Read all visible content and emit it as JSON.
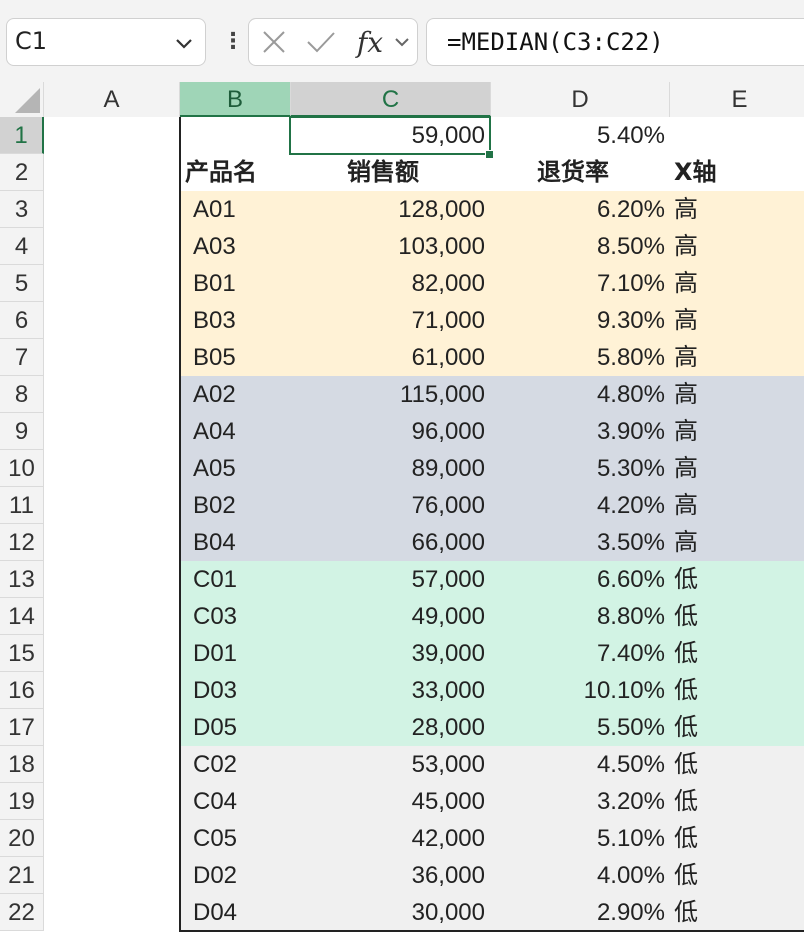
{
  "name_box": {
    "value": "C1"
  },
  "formula_bar": {
    "formula": "=MEDIAN(C3:C22)"
  },
  "columns": [
    "A",
    "B",
    "C",
    "D",
    "E"
  ],
  "header_row": {
    "product": "产品名",
    "sales": "销售额",
    "return_rate": "退货率",
    "x_axis": "X轴"
  },
  "row1": {
    "C": "59,000",
    "D": "5.40%"
  },
  "rows": [
    {
      "num": "3",
      "product": "A01",
      "sales": "128,000",
      "rate": "6.20%",
      "x": "高"
    },
    {
      "num": "4",
      "product": "A03",
      "sales": "103,000",
      "rate": "8.50%",
      "x": "高"
    },
    {
      "num": "5",
      "product": "B01",
      "sales": "82,000",
      "rate": "7.10%",
      "x": "高"
    },
    {
      "num": "6",
      "product": "B03",
      "sales": "71,000",
      "rate": "9.30%",
      "x": "高"
    },
    {
      "num": "7",
      "product": "B05",
      "sales": "61,000",
      "rate": "5.80%",
      "x": "高"
    },
    {
      "num": "8",
      "product": "A02",
      "sales": "115,000",
      "rate": "4.80%",
      "x": "高"
    },
    {
      "num": "9",
      "product": "A04",
      "sales": "96,000",
      "rate": "3.90%",
      "x": "高"
    },
    {
      "num": "10",
      "product": "A05",
      "sales": "89,000",
      "rate": "5.30%",
      "x": "高"
    },
    {
      "num": "11",
      "product": "B02",
      "sales": "76,000",
      "rate": "4.20%",
      "x": "高"
    },
    {
      "num": "12",
      "product": "B04",
      "sales": "66,000",
      "rate": "3.50%",
      "x": "高"
    },
    {
      "num": "13",
      "product": "C01",
      "sales": "57,000",
      "rate": "6.60%",
      "x": "低"
    },
    {
      "num": "14",
      "product": "C03",
      "sales": "49,000",
      "rate": "8.80%",
      "x": "低"
    },
    {
      "num": "15",
      "product": "D01",
      "sales": "39,000",
      "rate": "7.40%",
      "x": "低"
    },
    {
      "num": "16",
      "product": "D03",
      "sales": "33,000",
      "rate": "10.10%",
      "x": "低"
    },
    {
      "num": "17",
      "product": "D05",
      "sales": "28,000",
      "rate": "5.50%",
      "x": "低"
    },
    {
      "num": "18",
      "product": "C02",
      "sales": "53,000",
      "rate": "4.50%",
      "x": "低"
    },
    {
      "num": "19",
      "product": "C04",
      "sales": "45,000",
      "rate": "3.20%",
      "x": "低"
    },
    {
      "num": "20",
      "product": "C05",
      "sales": "42,000",
      "rate": "5.10%",
      "x": "低"
    },
    {
      "num": "21",
      "product": "D02",
      "sales": "36,000",
      "rate": "4.00%",
      "x": "低"
    },
    {
      "num": "22",
      "product": "D04",
      "sales": "30,000",
      "rate": "2.90%",
      "x": "低"
    }
  ],
  "row_labels": [
    "1",
    "2"
  ],
  "colors": {
    "band_yellow": "#fff2d6",
    "band_blue": "#d5dae3",
    "band_green": "#d2f3e4",
    "band_gray": "#f0f0f0",
    "accent": "#217346"
  },
  "icons": {
    "cancel": "x-icon",
    "confirm": "check-icon",
    "function": "fx-icon",
    "dropdown": "chevron-down-icon"
  }
}
